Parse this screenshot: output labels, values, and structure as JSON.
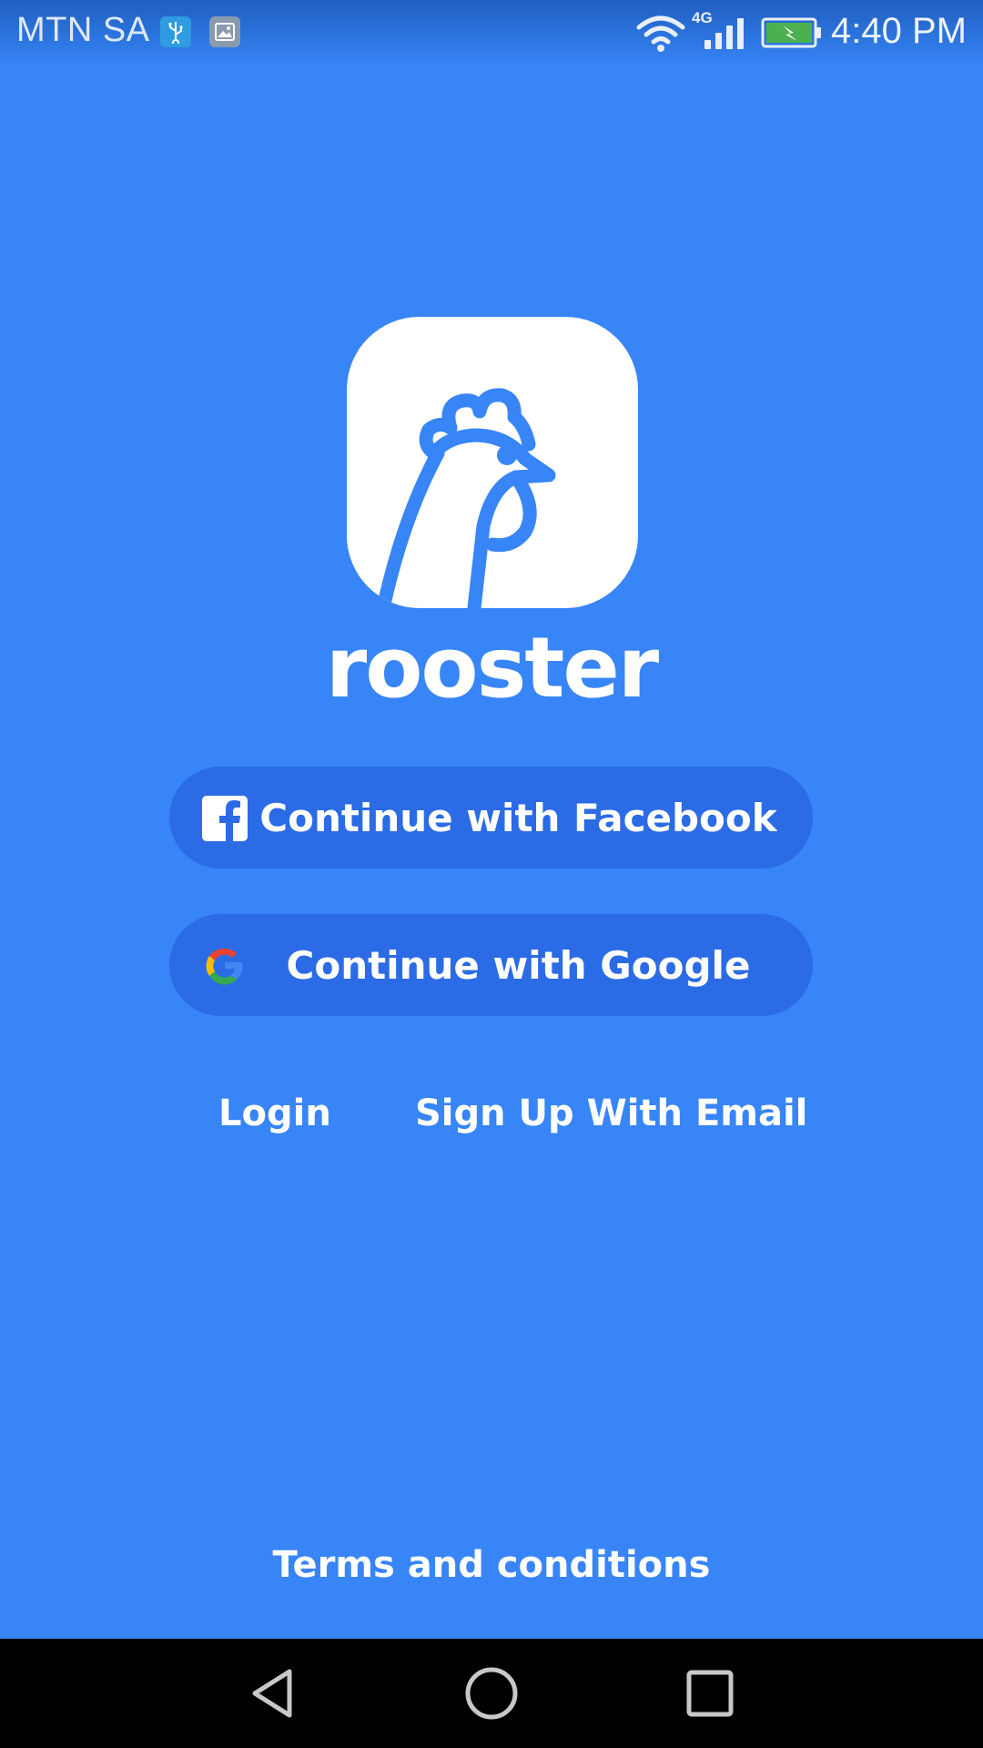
{
  "status_bar": {
    "carrier": "MTN SA",
    "network_type": "4G",
    "time": "4:40 PM",
    "icons": [
      "usb-icon",
      "image-icon",
      "wifi-icon",
      "signal-icon",
      "battery-charging-icon"
    ],
    "battery_color": "#4CAF50"
  },
  "app": {
    "brand_name": "rooster",
    "logo_icon": "rooster-logo-icon",
    "background_color": "#3785F7",
    "button_color": "#2B6BE5"
  },
  "auth": {
    "facebook_label": "Continue with Facebook",
    "google_label": "Continue with Google",
    "login_label": "Login",
    "signup_label": "Sign Up With Email",
    "terms_label": "Terms and conditions"
  },
  "nav_bar": {
    "icons": [
      "back-icon",
      "home-icon",
      "recents-icon"
    ]
  }
}
